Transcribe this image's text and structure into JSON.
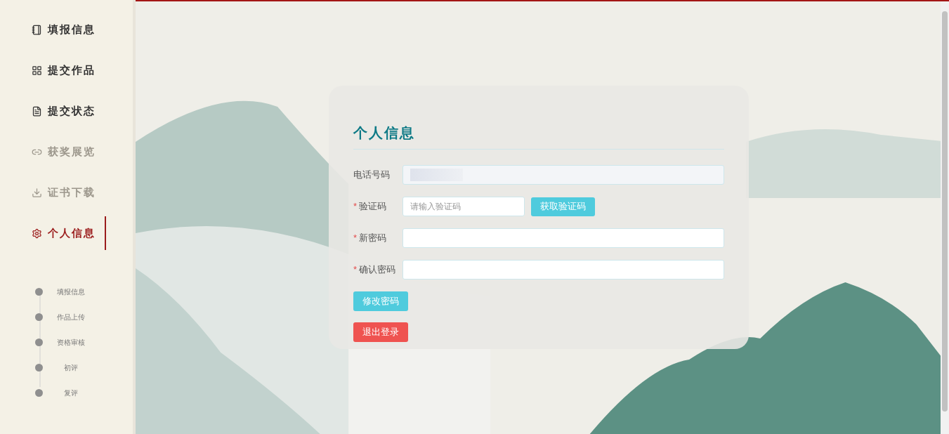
{
  "sidebar": {
    "items": [
      {
        "label": "填报信息",
        "disabled": false,
        "selected": false
      },
      {
        "label": "提交作品",
        "disabled": false,
        "selected": false
      },
      {
        "label": "提交状态",
        "disabled": false,
        "selected": false
      },
      {
        "label": "获奖展览",
        "disabled": true,
        "selected": false
      },
      {
        "label": "证书下载",
        "disabled": true,
        "selected": false
      },
      {
        "label": "个人信息",
        "disabled": false,
        "selected": true
      }
    ],
    "steps": [
      {
        "label": "填报信息"
      },
      {
        "label": "作品上传"
      },
      {
        "label": "资格审核"
      },
      {
        "label": "初评"
      },
      {
        "label": "复评"
      }
    ]
  },
  "card": {
    "title": "个人信息",
    "fields": [
      {
        "label": "电话号码",
        "disabled": true,
        "masked": true
      },
      {
        "label": "验证码",
        "required_mark": "*",
        "disabled": false,
        "placeholder": "请输入验证码",
        "action": "获取验证码"
      },
      {
        "label": "新密码",
        "required_mark": "*",
        "disabled": false
      },
      {
        "label": "确认密码",
        "required_mark": "*",
        "disabled": false
      }
    ],
    "buttons": [
      {
        "label": "修改密码",
        "kind": "primary"
      },
      {
        "label": "退出登录",
        "kind": "danger"
      }
    ]
  }
}
